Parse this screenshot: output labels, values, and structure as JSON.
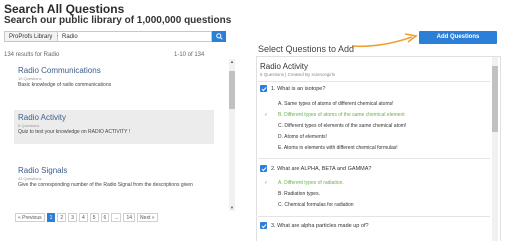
{
  "page": {
    "title": "Search All Questions",
    "subtitle": "Search our public library of 1,000,000 questions"
  },
  "search": {
    "library_label": "ProProfs Library",
    "query": "Radio",
    "icon": "search-icon"
  },
  "results": {
    "count_text": "134 results for Radio",
    "range_text": "1-10 of 134",
    "items": [
      {
        "title": "Radio Communications",
        "meta": "10 Questions",
        "desc": "Basic knowledge of radio communications"
      },
      {
        "title": "Radio Activity",
        "meta": "6 Questions",
        "desc": "Quiz to test your knowledge on RADIO ACTIVITY !"
      },
      {
        "title": "Radio Signals",
        "meta": "43 Questions",
        "desc": "Give the corresponding number of the Radio Signal from the descriptions given"
      }
    ]
  },
  "pagination": {
    "prev": "« Previous",
    "pages": [
      "1",
      "2",
      "3",
      "4",
      "5",
      "6",
      "...",
      "14"
    ],
    "next": "Next »"
  },
  "right_panel": {
    "add_button": "Add Questions",
    "heading": "Select Questions to Add",
    "quiz_title": "Radio Activity",
    "quiz_meta": "6 Questions | Created By sciencegirls",
    "questions": [
      {
        "text": "1. What is an isotope?",
        "answers": [
          "A.  Same types of atoms of different chemical atoms!",
          "B.  Different types of atoms of the same chemical element",
          "C.  Different types of elements of the same chemical atom!",
          "D.  Atoms of elements!",
          "E.  Atoms in elements with different chemical formulas!"
        ],
        "correct_index": 1
      },
      {
        "text": "2. What are ALPHA, BETA and GAMMA?",
        "answers": [
          "A.  Different types of radiation.",
          "B.  Radiation types.",
          "C.  Chemical formulas for radiation"
        ],
        "correct_index": 0
      },
      {
        "text": "3. What are alpha particles made up of?",
        "answers": [],
        "correct_index": -1
      }
    ]
  },
  "colors": {
    "accent": "#2c7fd6",
    "correct": "#6ab04c",
    "link": "#3d5d8a",
    "arrow": "#f0a030"
  }
}
